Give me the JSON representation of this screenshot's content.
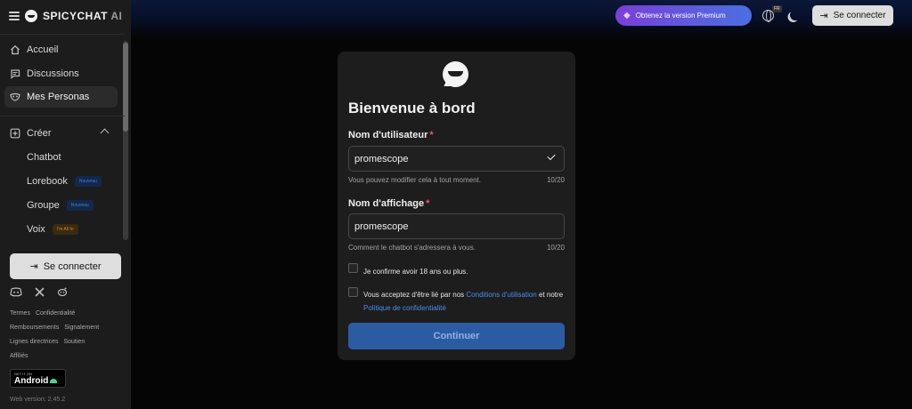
{
  "brand": {
    "name": "SPICYCHAT",
    "suffix": "AI"
  },
  "sidebar": {
    "nav": [
      {
        "label": "Accueil",
        "icon": "home-icon"
      },
      {
        "label": "Discussions",
        "icon": "chat-icon"
      },
      {
        "label": "Mes Personas",
        "icon": "mask-icon",
        "active": true
      }
    ],
    "create": {
      "label": "Créer",
      "icon": "plus-square-icon"
    },
    "create_items": [
      {
        "label": "Chatbot"
      },
      {
        "label": "Lorebook",
        "badge": "Nouveau"
      },
      {
        "label": "Groupe",
        "badge": "Nouveau"
      },
      {
        "label": "Voix",
        "badge": "I'm All In"
      }
    ],
    "login_label": "Se connecter",
    "footer_links": [
      "Termes",
      "Confidentialité",
      "Remboursements",
      "Signalement",
      "Lignes directrices",
      "Soutien",
      "Affiliés"
    ],
    "android": {
      "top": "GET IT ON",
      "name": "Android"
    },
    "version": "Web version: 2.45.2"
  },
  "topbar": {
    "premium_label": "Obtenez la version Premium",
    "lang_badge": "FR",
    "login_label": "Se connecter"
  },
  "modal": {
    "title": "Bienvenue à bord",
    "username": {
      "label": "Nom d'utilisateur",
      "value": "promescope",
      "hint": "Vous pouvez modifier cela à tout moment.",
      "count": "10/20"
    },
    "display_name": {
      "label": "Nom d'affichage",
      "value": "promescope",
      "hint": "Comment le chatbot s'adressera à vous.",
      "count": "10/20"
    },
    "age_confirm": "Je confirme avoir 18 ans ou plus.",
    "terms": {
      "prefix": "Vous acceptez d'être lié par nos",
      "terms_link": "Conditions d'utilisation",
      "middle": "et notre",
      "privacy_link": "Politique de confidentialité"
    },
    "continue_label": "Continuer",
    "required_mark": "*"
  }
}
